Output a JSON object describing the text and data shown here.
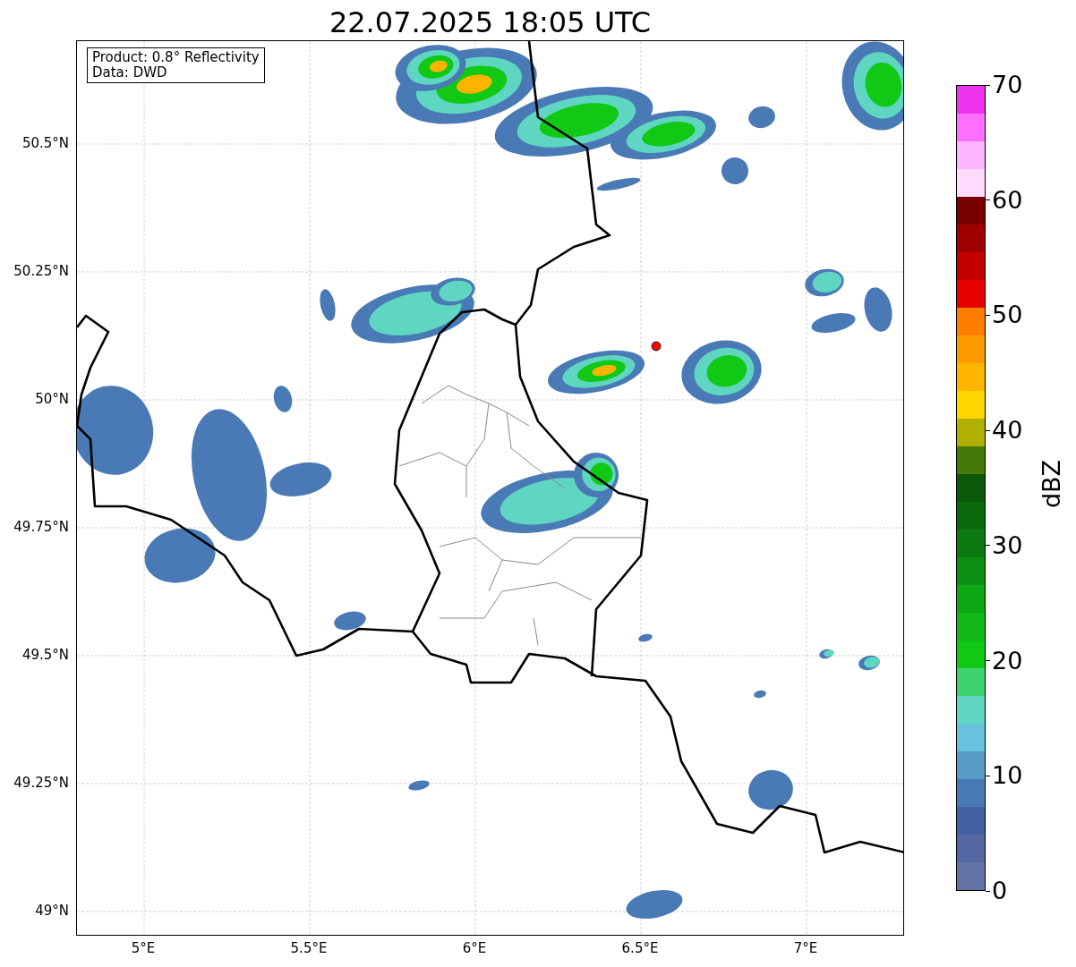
{
  "title": "22.07.2025 18:05 UTC",
  "info_box": {
    "lines": [
      "Product: 0.8° Reflectivity",
      "Data: DWD"
    ]
  },
  "map": {
    "lat_labels": [
      "50.5°N",
      "50.25°N",
      "50°N",
      "49.75°N",
      "49.5°N",
      "49.25°N",
      "49°N"
    ],
    "lon_labels": [
      "5°E",
      "5.5°E",
      "6°E",
      "6.5°E",
      "7°E"
    ]
  },
  "colorbar": {
    "label": "dBZ",
    "ticks": [
      "70",
      "60",
      "50",
      "40",
      "30",
      "20",
      "10",
      "0"
    ],
    "bins": [
      {
        "color": "#ee33ee"
      },
      {
        "color": "#ff6eff"
      },
      {
        "color": "#ffb4ff"
      },
      {
        "color": "#ffdcff"
      },
      {
        "color": "#7a0000"
      },
      {
        "color": "#a00000"
      },
      {
        "color": "#c20000"
      },
      {
        "color": "#e60000"
      },
      {
        "color": "#ff7e00"
      },
      {
        "color": "#ff9a00"
      },
      {
        "color": "#ffb400"
      },
      {
        "color": "#ffd700"
      },
      {
        "color": "#b0b000"
      },
      {
        "color": "#457a0a"
      },
      {
        "color": "#0a5a0a"
      },
      {
        "color": "#0a6a0c"
      },
      {
        "color": "#0b7a10"
      },
      {
        "color": "#0e8f12"
      },
      {
        "color": "#0ea814"
      },
      {
        "color": "#10b818"
      },
      {
        "color": "#11c814"
      },
      {
        "color": "#3dd46f"
      },
      {
        "color": "#5fd6c2"
      },
      {
        "color": "#66c2de"
      },
      {
        "color": "#589cc7"
      },
      {
        "color": "#4a7ab5"
      },
      {
        "color": "#4461a4"
      },
      {
        "color": "#5467a0"
      },
      {
        "color": "#6473a6"
      }
    ]
  }
}
